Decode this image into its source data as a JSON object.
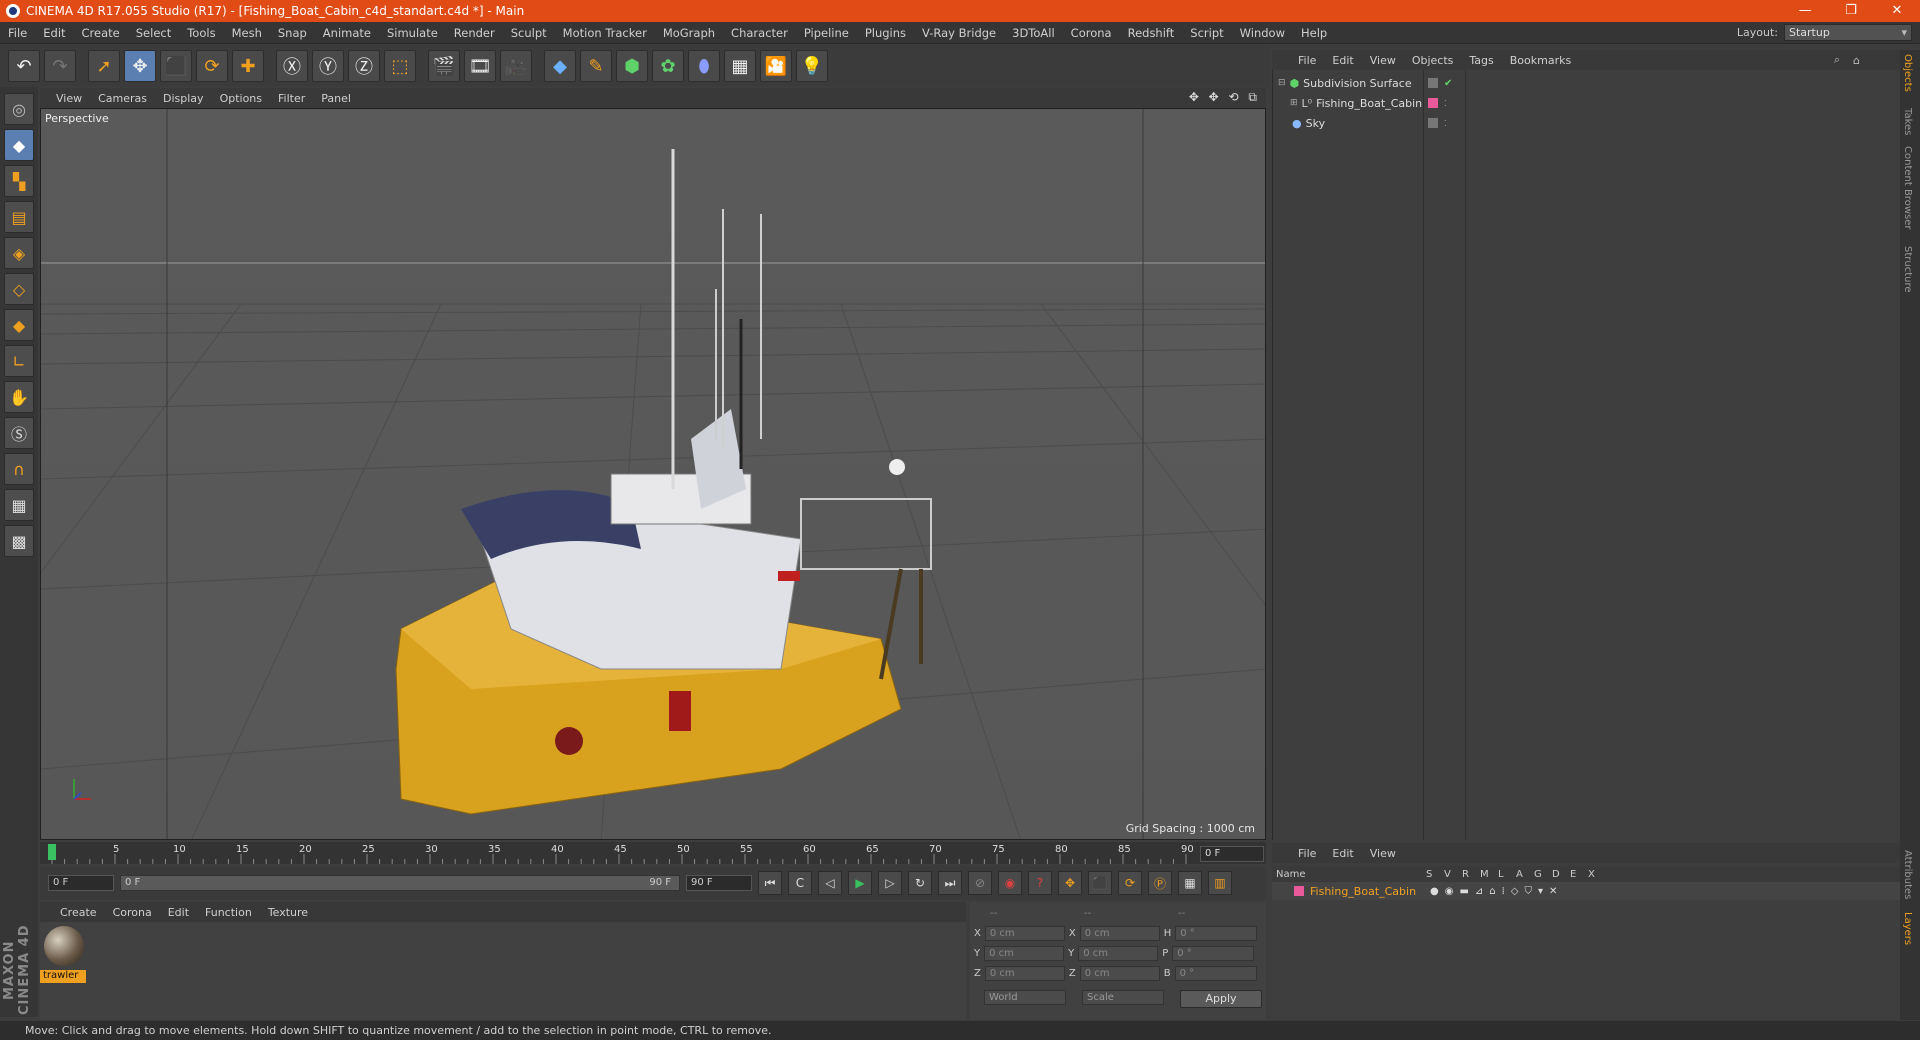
{
  "titlebar": {
    "title": "CINEMA 4D R17.055 Studio (R17) - [Fishing_Boat_Cabin_c4d_standart.c4d *] - Main",
    "min": "—",
    "max": "❐",
    "close": "✕"
  },
  "menubar": {
    "items": [
      "File",
      "Edit",
      "Create",
      "Select",
      "Tools",
      "Mesh",
      "Snap",
      "Animate",
      "Simulate",
      "Render",
      "Sculpt",
      "Motion Tracker",
      "MoGraph",
      "Character",
      "Pipeline",
      "Plugins",
      "V-Ray Bridge",
      "3DToAll",
      "Corona",
      "Redshift",
      "Script",
      "Window",
      "Help"
    ],
    "layout_label": "Layout:",
    "layout_value": "Startup"
  },
  "viewport": {
    "menu": [
      "View",
      "Cameras",
      "Display",
      "Options",
      "Filter",
      "Panel"
    ],
    "label": "Perspective",
    "grid_spacing": "Grid Spacing : 1000 cm",
    "nav_icons": "✥ ✥ ⟲ ⧉"
  },
  "timeline": {
    "ticks": [
      "0",
      "5",
      "10",
      "15",
      "20",
      "25",
      "30",
      "35",
      "40",
      "45",
      "50",
      "55",
      "60",
      "65",
      "70",
      "75",
      "80",
      "85",
      "90"
    ],
    "current": "0 F"
  },
  "controls": {
    "start": "0 F",
    "range_start": "0 F",
    "range_end": "90 F",
    "end": "90 F"
  },
  "materials": {
    "menu": [
      "Create",
      "Corona",
      "Edit",
      "Function",
      "Texture"
    ],
    "items": [
      {
        "name": "trawler"
      }
    ]
  },
  "coordinates": {
    "header": [
      "--",
      "--",
      "--"
    ],
    "rows": [
      {
        "a": "X",
        "av": "0 cm",
        "b": "X",
        "bv": "0 cm",
        "c": "H",
        "cv": "0 °"
      },
      {
        "a": "Y",
        "av": "0 cm",
        "b": "Y",
        "bv": "0 cm",
        "c": "P",
        "cv": "0 °"
      },
      {
        "a": "Z",
        "av": "0 cm",
        "b": "Z",
        "bv": "0 cm",
        "c": "B",
        "cv": "0 °"
      }
    ],
    "mode1": "World",
    "mode2": "Scale",
    "apply": "Apply"
  },
  "objects": {
    "menu": [
      "File",
      "Edit",
      "View",
      "Objects",
      "Tags",
      "Bookmarks"
    ],
    "items": [
      {
        "name": "Subdivision Surface"
      },
      {
        "name": "Fishing_Boat_Cabin"
      },
      {
        "name": "Sky"
      }
    ]
  },
  "sidetabs": [
    "Objects",
    "Takes",
    "Content Browser",
    "Structure",
    "Attributes",
    "Layers"
  ],
  "layers": {
    "menu": [
      "File",
      "Edit",
      "View"
    ],
    "columns": [
      "Name",
      "S",
      "V",
      "R",
      "M",
      "L",
      "A",
      "G",
      "D",
      "E",
      "X"
    ],
    "items": [
      {
        "name": "Fishing_Boat_Cabin"
      }
    ]
  },
  "status": "Move: Click and drag to move elements. Hold down SHIFT to quantize movement / add to the selection in point mode, CTRL to remove.",
  "logo": "MAXON CINEMA 4D",
  "colors": {
    "accent": "#e04b16",
    "material_label": "#f0a020",
    "layer_color": "#e85a9a",
    "hull": "#d9a21e"
  }
}
